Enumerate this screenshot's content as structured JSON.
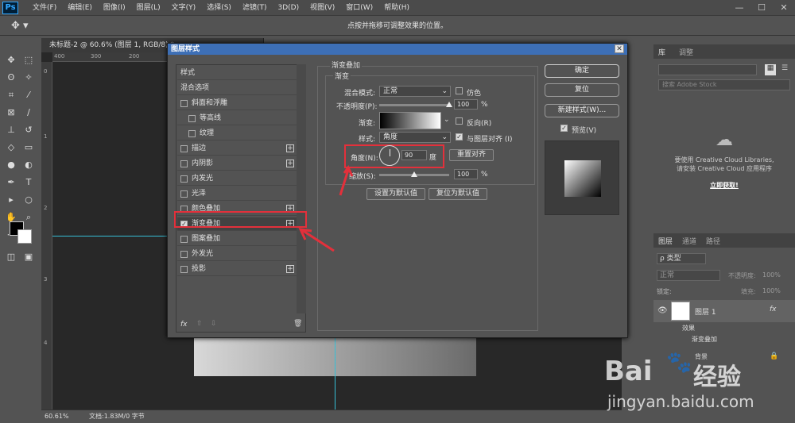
{
  "app": {
    "logo": "Ps",
    "menus": [
      "文件(F)",
      "编辑(E)",
      "图像(I)",
      "图层(L)",
      "文字(Y)",
      "选择(S)",
      "滤镜(T)",
      "3D(D)",
      "视图(V)",
      "窗口(W)",
      "帮助(H)"
    ],
    "min": "—",
    "max": "☐",
    "close": "✕"
  },
  "options": {
    "hint": "点按并拖移可调整效果的位置。"
  },
  "document": {
    "tab_title": "未标题-2 @ 60.6% (图层 1, RGB/8) *",
    "zoom": "60.61%",
    "doc_info": "文档:1.83M/0 字节",
    "ruler_top": [
      "400",
      "300",
      "200"
    ],
    "ruler_left": [
      "0",
      "1",
      "2",
      "3",
      "4"
    ]
  },
  "dialog": {
    "title": "图层样式",
    "close": "✕",
    "style_items": [
      {
        "label": "样式",
        "has_cb": false,
        "has_plus": false,
        "checked": false,
        "indent": false
      },
      {
        "label": "混合选项",
        "has_cb": false,
        "has_plus": false,
        "checked": false,
        "indent": false
      },
      {
        "label": "斜面和浮雕",
        "has_cb": true,
        "has_plus": false,
        "checked": false,
        "indent": false
      },
      {
        "label": "等高线",
        "has_cb": true,
        "has_plus": false,
        "checked": false,
        "indent": true
      },
      {
        "label": "纹理",
        "has_cb": true,
        "has_plus": false,
        "checked": false,
        "indent": true
      },
      {
        "label": "描边",
        "has_cb": true,
        "has_plus": true,
        "checked": false,
        "indent": false
      },
      {
        "label": "内阴影",
        "has_cb": true,
        "has_plus": true,
        "checked": false,
        "indent": false
      },
      {
        "label": "内发光",
        "has_cb": true,
        "has_plus": false,
        "checked": false,
        "indent": false
      },
      {
        "label": "光泽",
        "has_cb": true,
        "has_plus": false,
        "checked": false,
        "indent": false
      },
      {
        "label": "颜色叠加",
        "has_cb": true,
        "has_plus": true,
        "checked": false,
        "indent": false
      },
      {
        "label": "渐变叠加",
        "has_cb": true,
        "has_plus": true,
        "checked": true,
        "indent": false
      },
      {
        "label": "图案叠加",
        "has_cb": true,
        "has_plus": false,
        "checked": false,
        "indent": false
      },
      {
        "label": "外发光",
        "has_cb": true,
        "has_plus": false,
        "checked": false,
        "indent": false
      },
      {
        "label": "投影",
        "has_cb": true,
        "has_plus": true,
        "checked": false,
        "indent": false
      }
    ],
    "fx": "fx",
    "section_title": "渐变叠加",
    "group_title": "渐变",
    "blend_label": "混合模式:",
    "blend_value": "正常",
    "dither_label": "仿色",
    "opacity_label": "不透明度(P):",
    "opacity_value": "100",
    "opacity_fraction": 1.0,
    "pct": "%",
    "gradient_label": "渐变:",
    "reverse_label": "反向(R)",
    "style_label": "样式:",
    "style_value": "角度",
    "align_label": "与图层对齐 (I)",
    "angle_label": "角度(N):",
    "angle_value": "90",
    "angle_unit": "度",
    "reset_align": "重置对齐",
    "scale_label": "缩放(S):",
    "scale_value": "100",
    "scale_fraction": 0.5,
    "set_default": "设置为默认值",
    "reset_default": "复位为默认值",
    "ok": "确定",
    "reset": "复位",
    "new_style": "新建样式(W)...",
    "preview_label": "预览(V)"
  },
  "right_panel": {
    "tab_library": "库",
    "tab_adjust": "调整",
    "search_placeholder": "搜索 Adobe Stock",
    "cc_msg1": "要使用 Creative Cloud Libraries,",
    "cc_msg2": "请安装 Creative Cloud 应用程序",
    "cc_link": "立即获取!",
    "tab_layers": "图层",
    "tab_channels": "通道",
    "tab_paths": "路径",
    "kind": "ρ 类型",
    "blend": "正常",
    "opacity_label": "不透明度:",
    "opacity": "100%",
    "lock_label": "锁定:",
    "fill_label": "填充:",
    "fill": "100%",
    "layer1": "图层 1",
    "effects": "效果",
    "gradient_overlay": "渐变叠加",
    "background": "背景"
  },
  "watermark": {
    "brand": "Bai",
    "brand2": "经验",
    "url": "jingyan.baidu.com"
  },
  "colors": {
    "accent": "#3d6fb6",
    "highlight": "#e3303b",
    "guide": "#36bfd6"
  }
}
